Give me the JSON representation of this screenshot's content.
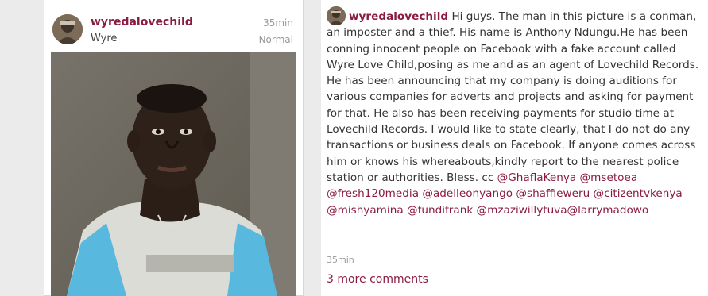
{
  "post": {
    "username": "wyredalovechild",
    "subtitle": "Wyre",
    "time": "35min",
    "filter": "Normal"
  },
  "comment": {
    "author": "wyredalovechild",
    "text": "Hi guys. The man in this picture is a conman, an imposter and a thief. His name is Anthony Ndungu.He has been conning innocent people on Facebook with a fake account called Wyre Love Child,posing as me and as an agent of Lovechild Records. He has been announcing that my company is doing auditions for various companies for adverts and projects and asking for payment for that. He also has been receiving payments for studio time at Lovechild Records. I would like to state clearly, that I do not do any transactions or business deals on Facebook. If anyone comes across him or knows his whereabouts,kindly report to the nearest police station or authorities. Bless. cc",
    "mentions": [
      "@GhaflaKenya",
      "@msetoea",
      "@fresh120media",
      "@adelleonyango",
      "@shaffieweru",
      "@citizentvkenya",
      "@mishyamina",
      "@fundifrank",
      "@mzaziwillytuva@larrymadowo"
    ],
    "time": "35min"
  },
  "more_comments": "3 more comments",
  "colors": {
    "accent": "#8a1c3f",
    "muted": "#999999",
    "text": "#333333",
    "page_bg": "#ebebeb"
  },
  "icons": {
    "post_avatar": "avatar",
    "comment_avatar": "avatar"
  }
}
